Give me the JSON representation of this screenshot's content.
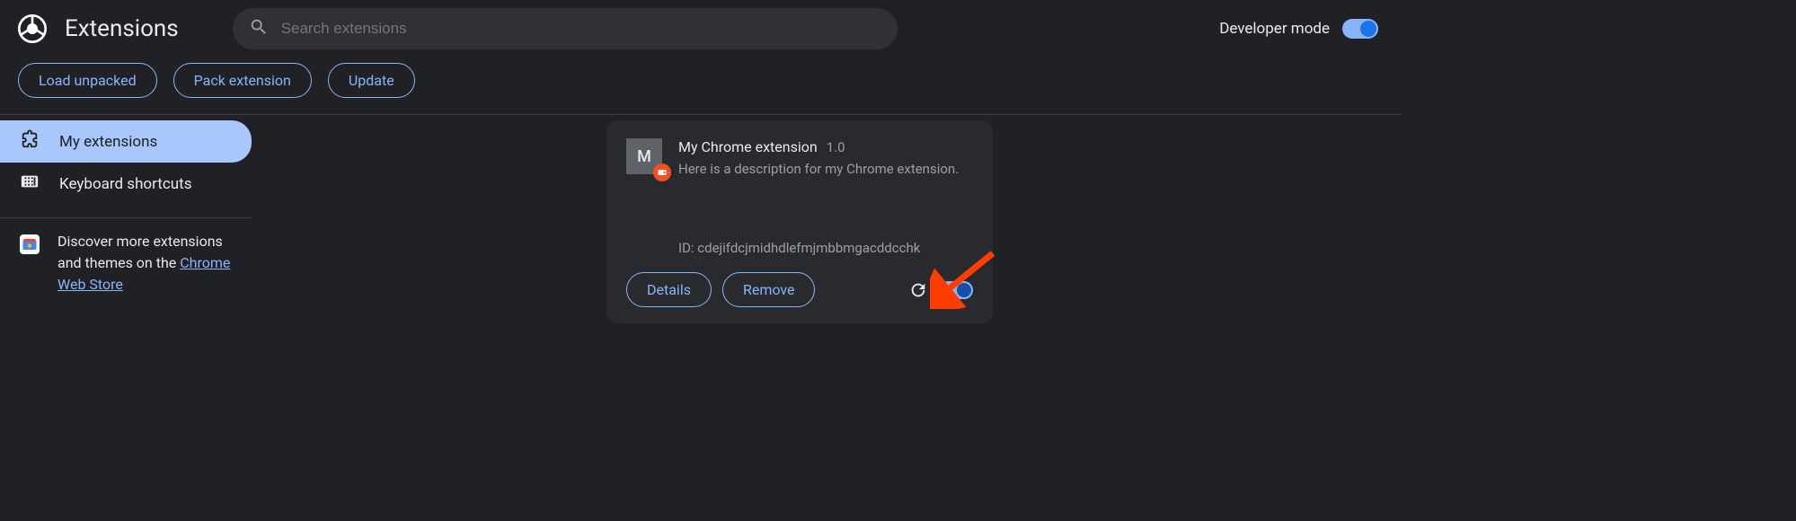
{
  "header": {
    "title": "Extensions",
    "search_placeholder": "Search extensions",
    "dev_mode_label": "Developer mode",
    "dev_mode_on": true
  },
  "dev_bar": {
    "load_unpacked": "Load unpacked",
    "pack_extension": "Pack extension",
    "update": "Update"
  },
  "sidebar": {
    "my_extensions": "My extensions",
    "keyboard_shortcuts": "Keyboard shortcuts",
    "promo_prefix": "Discover more extensions and themes on the ",
    "promo_link": "Chrome Web Store"
  },
  "extension": {
    "icon_letter": "M",
    "name": "My Chrome extension",
    "version": "1.0",
    "description": "Here is a description for my Chrome extension.",
    "id_label": "ID: ",
    "id_value": "cdejifdcjmidhdlefmjmbbmgacddcchk",
    "details_label": "Details",
    "remove_label": "Remove",
    "enabled": true
  }
}
